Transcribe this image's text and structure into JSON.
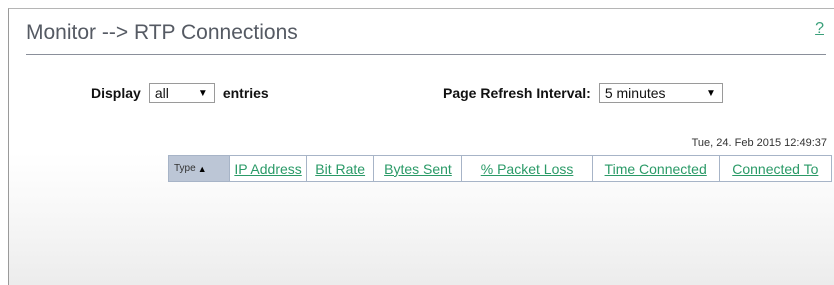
{
  "header": {
    "title": "Monitor --> RTP Connections",
    "help_label": "?"
  },
  "display": {
    "label": "Display",
    "selected": "all",
    "suffix": "entries"
  },
  "refresh": {
    "label": "Page Refresh Interval:",
    "selected": "5 minutes"
  },
  "timestamp": "Tue, 24. Feb 2015 12:49:37",
  "table": {
    "columns": [
      "Type",
      "IP Address",
      "Bit Rate",
      "Bytes Sent",
      "% Packet Loss",
      "Time Connected",
      "Connected To"
    ],
    "sort_indicator": "▲",
    "rows": []
  },
  "icons": {
    "dropdown": "chevron-down-icon",
    "sort": "sort-ascending-icon"
  },
  "colors": {
    "link": "#2a9a67",
    "title": "#555a63",
    "type_header_bg": "#bcc6d6"
  }
}
